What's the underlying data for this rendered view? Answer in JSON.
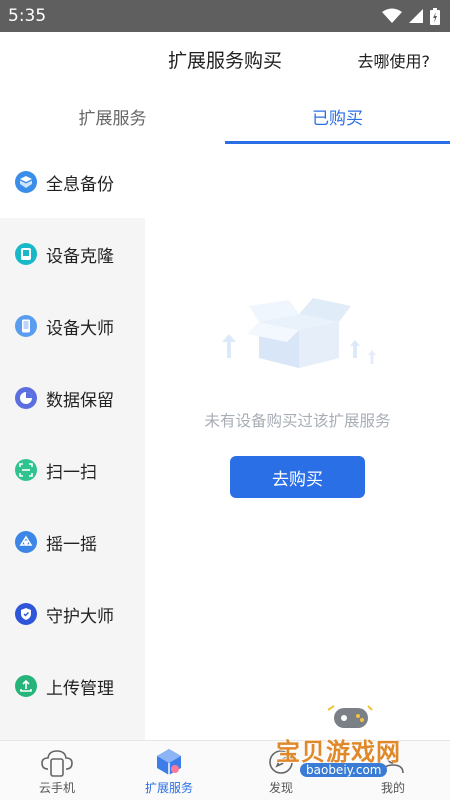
{
  "status_bar": {
    "time": "5:35"
  },
  "header": {
    "title": "扩展服务购买",
    "help": "去哪使用?"
  },
  "tabs": [
    {
      "label": "扩展服务",
      "selected": false
    },
    {
      "label": "已购买",
      "selected": true
    }
  ],
  "sidebar": {
    "items": [
      {
        "label": "全息备份",
        "icon": "cube-icon",
        "color": "#3a8de8",
        "active": true
      },
      {
        "label": "设备克隆",
        "icon": "clone-icon",
        "color": "#18b8c9"
      },
      {
        "label": "设备大师",
        "icon": "phone-icon",
        "color": "#5a9cf0"
      },
      {
        "label": "数据保留",
        "icon": "pie-icon",
        "color": "#5b6fe0"
      },
      {
        "label": "扫一扫",
        "icon": "scan-icon",
        "color": "#2fc48f"
      },
      {
        "label": "摇一摇",
        "icon": "shake-icon",
        "color": "#3b86e6"
      },
      {
        "label": "守护大师",
        "icon": "guard-icon",
        "color": "#2f56d8"
      },
      {
        "label": "上传管理",
        "icon": "upload-icon",
        "color": "#26b47a"
      }
    ]
  },
  "empty_state": {
    "message": "未有设备购买过该扩展服务",
    "button": "去购买"
  },
  "bottom_nav": [
    {
      "label": "云手机",
      "icon": "cloud-phone-icon"
    },
    {
      "label": "扩展服务",
      "icon": "extension-icon",
      "active": true
    },
    {
      "label": "发现",
      "icon": "discover-icon"
    },
    {
      "label": "我的",
      "icon": "profile-icon"
    }
  ],
  "watermark": {
    "text": "宝贝游戏网",
    "url": "baobeiy.com"
  },
  "colors": {
    "accent": "#2b6fe6",
    "status_bar": "#5f5f5f",
    "sidebar_bg": "#f5f5f5"
  }
}
